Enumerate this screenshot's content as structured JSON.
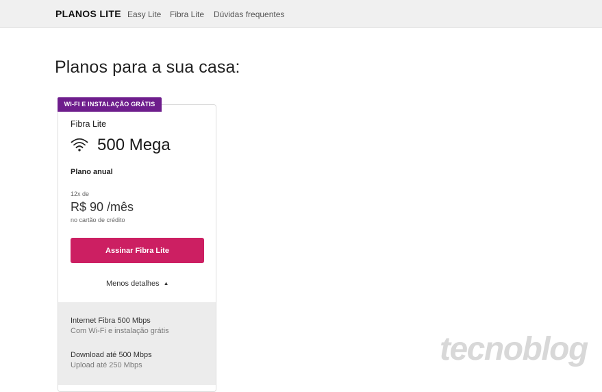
{
  "header": {
    "brand": "PLANOS LITE",
    "nav": [
      "Easy Lite",
      "Fibra Lite",
      "Dúvidas frequentes"
    ]
  },
  "page": {
    "title": "Planos para a sua casa:"
  },
  "plan": {
    "badge": "WI-FI E INSTALAÇÃO GRÁTIS",
    "name": "Fibra Lite",
    "speed_icon": "wifi-icon",
    "speed": "500 Mega",
    "term": "Plano anual",
    "installments": "12x de",
    "price": "R$ 90 /mês",
    "payment": "no cartão de crédito",
    "cta": "Assinar Fibra Lite",
    "details_toggle": "Menos detalhes",
    "details": [
      {
        "title": "Internet Fibra 500 Mbps",
        "subtitle": "Com Wi-Fi e instalação grátis"
      },
      {
        "title": "Download até 500 Mbps",
        "subtitle": "Upload até 250 Mbps"
      }
    ]
  },
  "watermark": "tecnoblog",
  "colors": {
    "badge": "#6e1d8c",
    "cta": "#cc1f62",
    "details_bg": "#ececec",
    "header_bg": "#f0f0f0"
  }
}
